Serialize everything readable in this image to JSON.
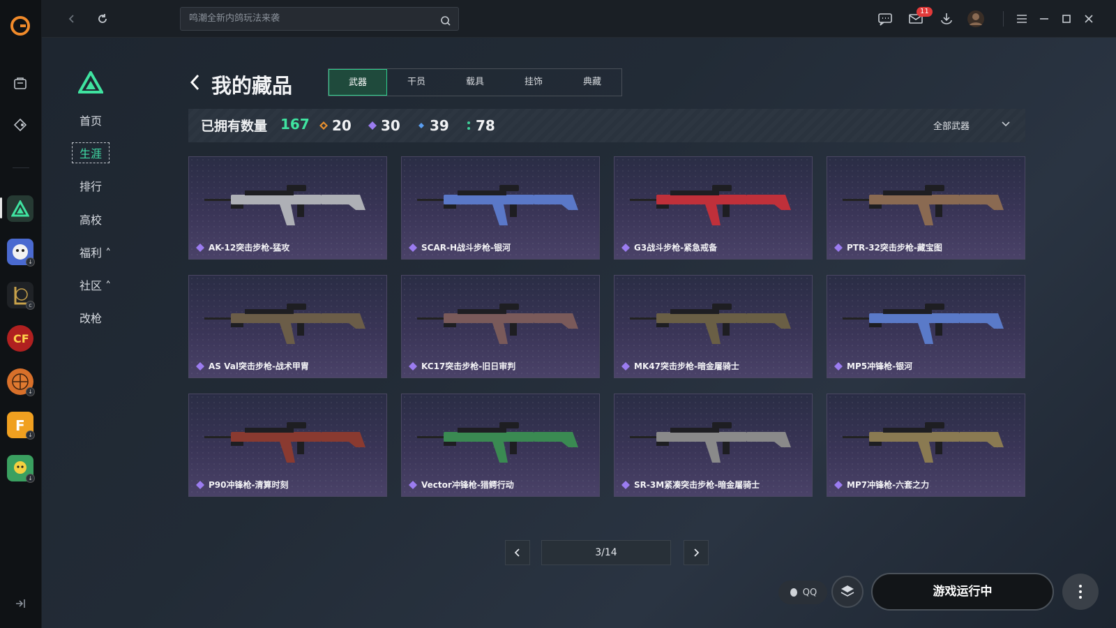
{
  "search": {
    "placeholder": "鸣潮全新内鸽玩法来袭"
  },
  "mail_badge": "11",
  "nav": {
    "items": [
      {
        "label": "首页"
      },
      {
        "label": "生涯"
      },
      {
        "label": "排行"
      },
      {
        "label": "高校"
      },
      {
        "label": "福利 ˄"
      },
      {
        "label": "社区 ˄"
      },
      {
        "label": "改枪"
      }
    ]
  },
  "page": {
    "title": "我的藏品"
  },
  "tabs": [
    {
      "label": "武器"
    },
    {
      "label": "干员"
    },
    {
      "label": "载具"
    },
    {
      "label": "挂饰"
    },
    {
      "label": "典藏"
    }
  ],
  "stats": {
    "owned_label": "已拥有数量",
    "owned_count": "167",
    "rarities": [
      {
        "value": "20",
        "color": "#e8902e"
      },
      {
        "value": "30",
        "color": "#9b7cf0"
      },
      {
        "value": "39",
        "color": "#5a9ef0"
      },
      {
        "value": "78",
        "color": "#3fd19a"
      }
    ],
    "filter_label": "全部武器"
  },
  "items": [
    {
      "label": "AK-12突击步枪-猛攻",
      "color": "#aeb0b6"
    },
    {
      "label": "SCAR-H战斗步枪-银河",
      "color": "#5a78c8"
    },
    {
      "label": "G3战斗步枪-紧急戒备",
      "color": "#c0303a"
    },
    {
      "label": "PTR-32突击步枪-藏宝图",
      "color": "#8a6a52"
    },
    {
      "label": "AS Val突击步枪-战术甲胄",
      "color": "#6b5d48"
    },
    {
      "label": "KC17突击步枪-旧日审判",
      "color": "#7a5a5a"
    },
    {
      "label": "MK47突击步枪-暗金屠骑士",
      "color": "#6a5f45"
    },
    {
      "label": "MP5冲锋枪-银河",
      "color": "#5a7ac8"
    },
    {
      "label": "P90冲锋枪-清算时刻",
      "color": "#8a3a30"
    },
    {
      "label": "Vector冲锋枪-猎鳄行动",
      "color": "#3a8a52"
    },
    {
      "label": "SR-3M紧凑突击步枪-暗金屠骑士",
      "color": "#8a8a8a"
    },
    {
      "label": "MP7冲锋枪-六套之力",
      "color": "#8a7a52"
    }
  ],
  "pager": {
    "text": "3/14"
  },
  "bottom": {
    "qq_label": "QQ",
    "run_label": "游戏运行中"
  }
}
